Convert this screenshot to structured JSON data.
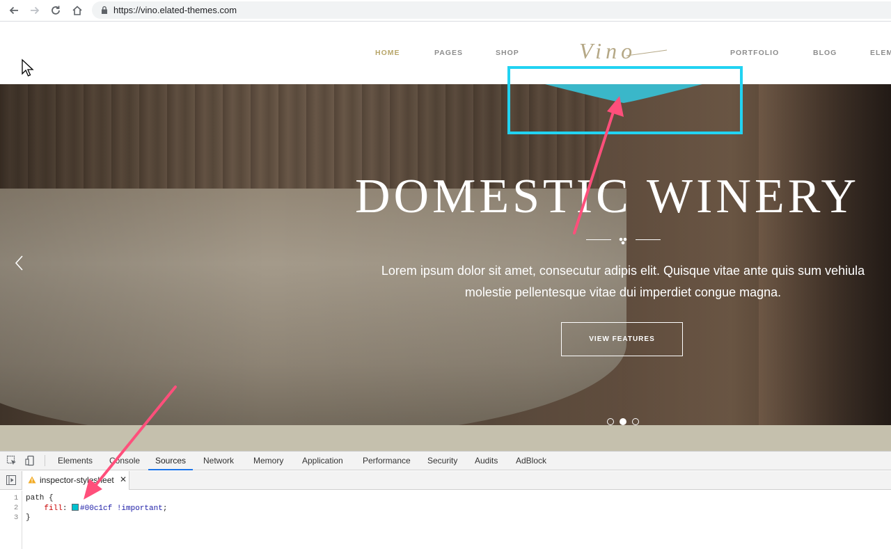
{
  "browser": {
    "url": "https://vino.elated-themes.com"
  },
  "site": {
    "logo_text": "Vino",
    "menu": [
      {
        "label": "HOME",
        "active": true
      },
      {
        "label": "PAGES"
      },
      {
        "label": "SHOP"
      },
      {
        "label": "PORTFOLIO"
      },
      {
        "label": "BLOG"
      },
      {
        "label": "ELEM"
      }
    ]
  },
  "hero": {
    "title": "DOMESTIC WINERY",
    "text_line1": "Lorem ipsum dolor sit amet, consecutur adipis elit. Quisque vitae ante quis sum vehiula",
    "text_line2": "molestie pellentesque vitae dui imperdiet congue magna.",
    "button_label": "VIEW FEATURES",
    "slides": 3,
    "active_slide": 2
  },
  "devtools": {
    "tabs": [
      "Elements",
      "Console",
      "Sources",
      "Network",
      "Memory",
      "Application",
      "Performance",
      "Security",
      "Audits",
      "AdBlock"
    ],
    "active_tab": "Sources",
    "file_tab": "inspector-stylesheet",
    "code": {
      "line1": "path {",
      "line2_prop": "fill",
      "line2_value": "#00c1cf !important",
      "line3": "}"
    },
    "line_numbers": [
      "1",
      "2",
      "3"
    ]
  },
  "colors": {
    "highlight": "#22d3f2",
    "fill_value": "#00c1cf",
    "annotation_arrow": "#ff4f7b",
    "menu_active": "#b8a66a"
  }
}
